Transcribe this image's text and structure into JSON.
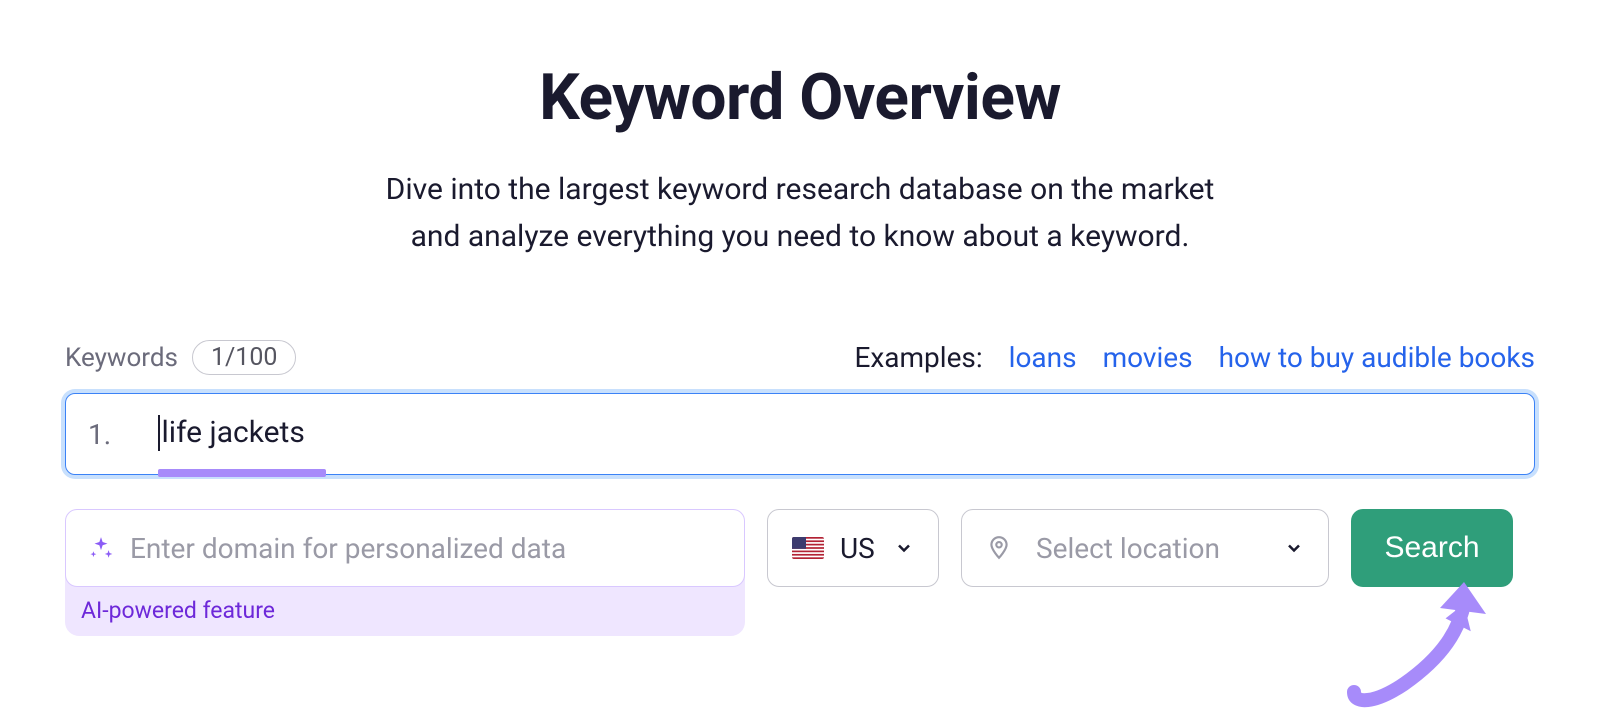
{
  "header": {
    "title": "Keyword Overview",
    "subtitle_line1": "Dive into the largest keyword research database on the market",
    "subtitle_line2": "and analyze everything you need to know about a keyword."
  },
  "keywords": {
    "label": "Keywords",
    "count": "1/100",
    "row_number": "1.",
    "value": "life jackets"
  },
  "examples": {
    "label": "Examples:",
    "items": [
      "loans",
      "movies",
      "how to buy audible books"
    ]
  },
  "domain": {
    "placeholder": "Enter domain for personalized data",
    "ai_caption": "AI-powered feature"
  },
  "country": {
    "code": "US"
  },
  "location": {
    "placeholder": "Select location"
  },
  "actions": {
    "search": "Search"
  },
  "colors": {
    "accent_blue": "#2563eb",
    "accent_purple": "#a78bfa",
    "ai_bg": "#efe6ff",
    "search_green": "#2f9e7a"
  }
}
